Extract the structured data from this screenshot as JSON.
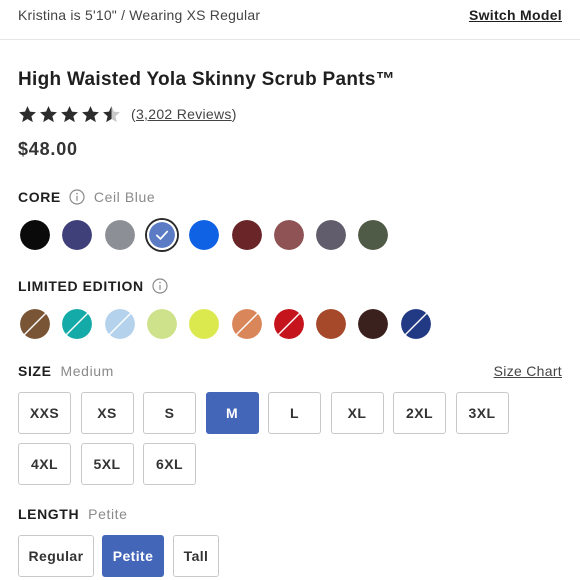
{
  "header": {
    "model_note": "Kristina is 5'10\" / Wearing XS Regular",
    "switch_model": "Switch Model"
  },
  "product": {
    "title": "High Waisted Yola Skinny Scrub Pants™",
    "rating": 4.5,
    "reviews_open": "(",
    "reviews_link": "3,202 Reviews",
    "reviews_close": ")",
    "price": "$48.00"
  },
  "core": {
    "label": "CORE",
    "selected_name": "Ceil Blue",
    "swatches": [
      {
        "color": "#0a0a0a",
        "selected": false,
        "split": null
      },
      {
        "color": "#3f3f7a",
        "selected": false,
        "split": null
      },
      {
        "color": "#8c8f96",
        "selected": false,
        "split": null
      },
      {
        "color": "#5b7cc4",
        "selected": true,
        "split": null
      },
      {
        "color": "#0f62e3",
        "selected": false,
        "split": null
      },
      {
        "color": "#6a2528",
        "selected": false,
        "split": null
      },
      {
        "color": "#8f5356",
        "selected": false,
        "split": null
      },
      {
        "color": "#615d6c",
        "selected": false,
        "split": null
      },
      {
        "color": "#4f5a47",
        "selected": false,
        "split": null
      }
    ]
  },
  "limited": {
    "label": "LIMITED EDITION",
    "swatches": [
      {
        "color": "#7a5535",
        "selected": false,
        "split": "#7a5535"
      },
      {
        "color": "#14aaa8",
        "selected": false,
        "split": "#14aaa8"
      },
      {
        "color": "#b5d2ec",
        "selected": false,
        "split": "#b5d2ec"
      },
      {
        "color": "#cde28a",
        "selected": false,
        "split": null
      },
      {
        "color": "#dbe84e",
        "selected": false,
        "split": null
      },
      {
        "color": "#d9875a",
        "selected": false,
        "split": "#d9875a"
      },
      {
        "color": "#c5141c",
        "selected": false,
        "split": "#c5141c"
      },
      {
        "color": "#a5492a",
        "selected": false,
        "split": null
      },
      {
        "color": "#3a211e",
        "selected": false,
        "split": null
      },
      {
        "color": "#213a83",
        "selected": false,
        "split": "#213a83"
      }
    ]
  },
  "size": {
    "label": "SIZE",
    "selected_name": "Medium",
    "chart_link": "Size Chart",
    "options": [
      {
        "label": "XXS",
        "active": false
      },
      {
        "label": "XS",
        "active": false
      },
      {
        "label": "S",
        "active": false
      },
      {
        "label": "M",
        "active": true
      },
      {
        "label": "L",
        "active": false
      },
      {
        "label": "XL",
        "active": false
      },
      {
        "label": "2XL",
        "active": false
      },
      {
        "label": "3XL",
        "active": false
      },
      {
        "label": "4XL",
        "active": false
      },
      {
        "label": "5XL",
        "active": false
      },
      {
        "label": "6XL",
        "active": false
      }
    ]
  },
  "length": {
    "label": "LENGTH",
    "selected_name": "Petite",
    "options": [
      {
        "label": "Regular",
        "active": false
      },
      {
        "label": "Petite",
        "active": true
      },
      {
        "label": "Tall",
        "active": false
      }
    ]
  },
  "colors": {
    "accent": "#4466b8",
    "star": "#2d2d2d",
    "star_empty": "#c8c8c8"
  },
  "icons": {
    "star": "star-icon",
    "info": "info-icon",
    "check": "check-icon"
  }
}
